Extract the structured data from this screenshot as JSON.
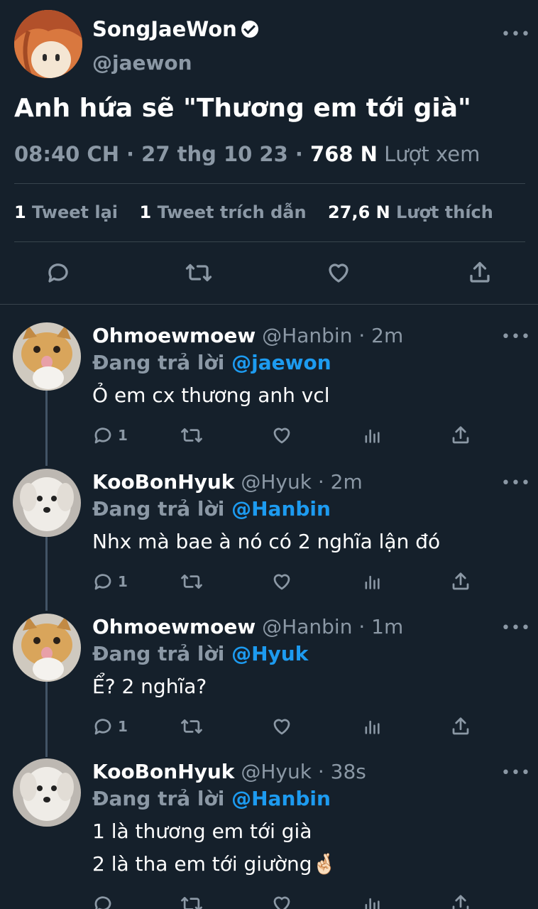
{
  "main": {
    "name": "SongJaeWon",
    "handle": "@jaewon",
    "more": "•••",
    "text": "Anh hứa sẽ \"Thương em tới già\"",
    "time": "08:40 CH · 27 thg 10 23 · ",
    "views_count": "768 N",
    "views_label": " Lượt xem",
    "stats": {
      "retweets_count": "1",
      "retweets_label": " Tweet lại",
      "quotes_count": "1",
      "quotes_label": " Tweet trích dẫn",
      "likes_count": "27,6 N",
      "likes_label": " Lượt thích"
    }
  },
  "replies": [
    {
      "name": "Ohmoewmoew",
      "handle": " @Hanbin · 2m",
      "reply_prefix": "Đang trả lời ",
      "reply_to": "@jaewon",
      "lines": [
        "Ỏ em cx thương anh vcl"
      ],
      "reply_count": "1",
      "more": "•••"
    },
    {
      "name": "KooBonHyuk",
      "handle": " @Hyuk · 2m",
      "reply_prefix": "Đang trả lời ",
      "reply_to": "@Hanbin",
      "lines": [
        "Nhx mà bae à nó có 2 nghĩa lận đó"
      ],
      "reply_count": "1",
      "more": "•••"
    },
    {
      "name": "Ohmoewmoew",
      "handle": " @Hanbin · 1m",
      "reply_prefix": "Đang trả lời ",
      "reply_to": "@Hyuk",
      "lines": [
        "Ể? 2 nghĩa?"
      ],
      "reply_count": "1",
      "more": "•••"
    },
    {
      "name": "KooBonHyuk",
      "handle": " @Hyuk · 38s",
      "reply_prefix": "Đang trả lời ",
      "reply_to": "@Hanbin",
      "lines": [
        "1 là thương em tới già",
        "2 là tha em tới giường🤞🏻"
      ],
      "reply_count": "",
      "more": "•••"
    }
  ],
  "icons": {
    "reply": "reply-icon",
    "retweet": "retweet-icon",
    "like": "heart-icon",
    "share": "share-icon",
    "analytics": "analytics-icon"
  },
  "colors": {
    "background": "#15202b",
    "accent": "#1d9bf0",
    "secondary_text": "#8b98a5"
  }
}
